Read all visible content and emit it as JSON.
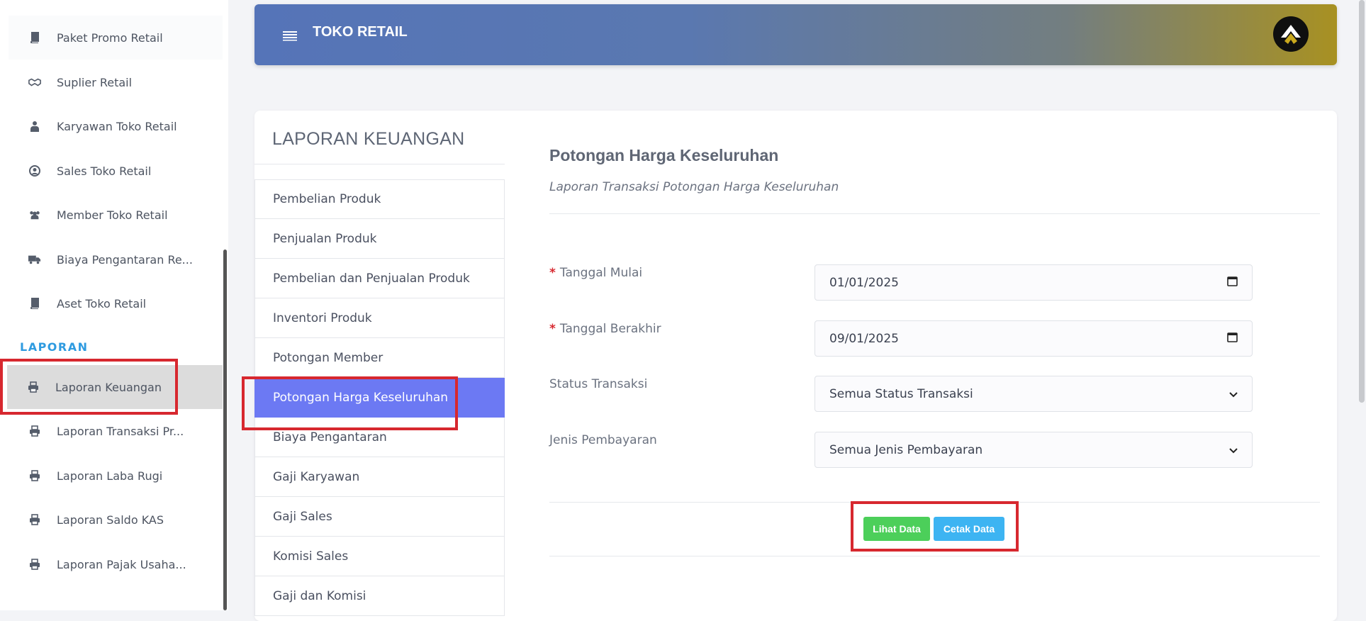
{
  "sidebar": {
    "items": [
      {
        "label": "Paket Promo Retail",
        "icon": "book-icon"
      },
      {
        "label": "Suplier Retail",
        "icon": "handshake-icon"
      },
      {
        "label": "Karyawan Toko Retail",
        "icon": "user-tie-icon"
      },
      {
        "label": "Sales Toko Retail",
        "icon": "user-circle-icon"
      },
      {
        "label": "Member Toko Retail",
        "icon": "users-icon"
      },
      {
        "label": "Biaya Pengantaran Re...",
        "icon": "truck-icon"
      },
      {
        "label": "Aset Toko Retail",
        "icon": "book-icon"
      }
    ],
    "section": "LAPORAN",
    "reports": [
      {
        "label": "Laporan Keuangan",
        "icon": "printer-icon"
      },
      {
        "label": "Laporan Transaksi Pr...",
        "icon": "printer-icon"
      },
      {
        "label": "Laporan Laba Rugi",
        "icon": "printer-icon"
      },
      {
        "label": "Laporan Saldo KAS",
        "icon": "printer-icon"
      },
      {
        "label": "Laporan Pajak Usaha...",
        "icon": "printer-icon"
      }
    ]
  },
  "header": {
    "title": "TOKO RETAIL"
  },
  "card": {
    "title": "LAPORAN KEUANGAN",
    "menu": [
      "Pembelian Produk",
      "Penjualan Produk",
      "Pembelian dan Penjualan Produk",
      "Inventori Produk",
      "Potongan Member",
      "Potongan Harga Keseluruhan",
      "Biaya Pengantaran",
      "Gaji Karyawan",
      "Gaji Sales",
      "Komisi Sales",
      "Gaji dan Komisi"
    ]
  },
  "report": {
    "title": "Potongan Harga Keseluruhan",
    "subtitle": "Laporan Transaksi Potongan Harga Keseluruhan",
    "required_mark": "*",
    "fields": {
      "start_label": "Tanggal Mulai",
      "start_value": "01/01/2025",
      "end_label": "Tanggal Berakhir",
      "end_value": "09/01/2025",
      "status_label": "Status Transaksi",
      "status_value": "Semua Status Transaksi",
      "payment_label": "Jenis Pembayaran",
      "payment_value": "Semua Jenis Pembayaran"
    },
    "buttons": {
      "view": "Lihat Data",
      "print": "Cetak Data"
    }
  },
  "colors": {
    "accent": "#6c79f3",
    "highlight": "#d7282f",
    "green": "#4ccf5a",
    "blue": "#3db4f2",
    "section": "#2f9be0"
  }
}
